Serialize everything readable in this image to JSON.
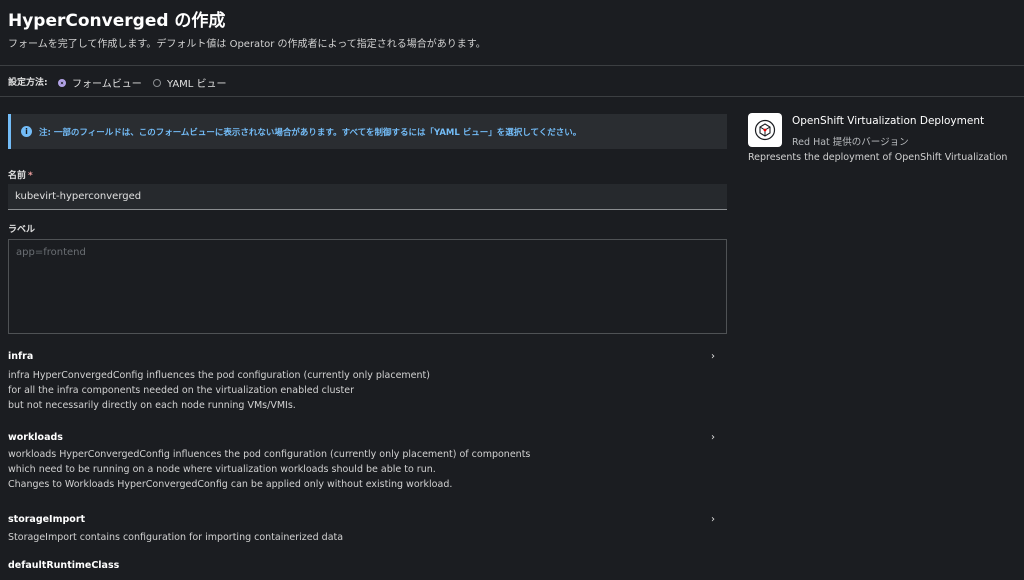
{
  "header": {
    "title": "HyperConverged の作成",
    "description": "フォームを完了して作成します。デフォルト値は Operator の作成者によって指定される場合があります。"
  },
  "config": {
    "label": "設定方法:",
    "form_view": "フォームビュー",
    "yaml_view": "YAML ビュー"
  },
  "alert": {
    "text": "注: 一部のフィールドは、このフォームビューに表示されない場合があります。すべてを制御するには「YAML ビュー」を選択してください。"
  },
  "form": {
    "name_label": "名前",
    "required_mark": "*",
    "name_value": "kubevirt-hyperconverged",
    "labels_label": "ラベル",
    "labels_placeholder": "app=frontend"
  },
  "sections": {
    "infra": {
      "title": "infra",
      "lines": [
        "infra HyperConvergedConfig influences the pod configuration (currently only placement)",
        "for all the infra components needed on the virtualization enabled cluster",
        "but not necessarily directly on each node running VMs/VMIs."
      ]
    },
    "workloads": {
      "title": "workloads",
      "lines": [
        "workloads HyperConvergedConfig influences the pod configuration (currently only placement) of components",
        "which need to be running on a node where virtualization workloads should be able to run.",
        "Changes to Workloads HyperConvergedConfig can be applied only without existing workload."
      ]
    },
    "storageImport": {
      "title": "storageImport",
      "lines": [
        "StorageImport contains configuration for importing containerized data"
      ]
    },
    "defaultRuntimeClass": {
      "title": "defaultRuntimeClass"
    }
  },
  "operator_card": {
    "title": "OpenShift Virtualization Deployment",
    "provider": "Red Hat 提供のバージョン",
    "description": "Represents the deployment of OpenShift Virtualization"
  },
  "icons": {
    "info": "info-circle-icon",
    "chevron": "chevron-right-icon",
    "logo": "operator-logo-icon"
  },
  "colors": {
    "background": "#1b1d21",
    "info_accent": "#73bcf7",
    "radio_selected": "#b2a3e6",
    "required": "#f0a0a0"
  }
}
